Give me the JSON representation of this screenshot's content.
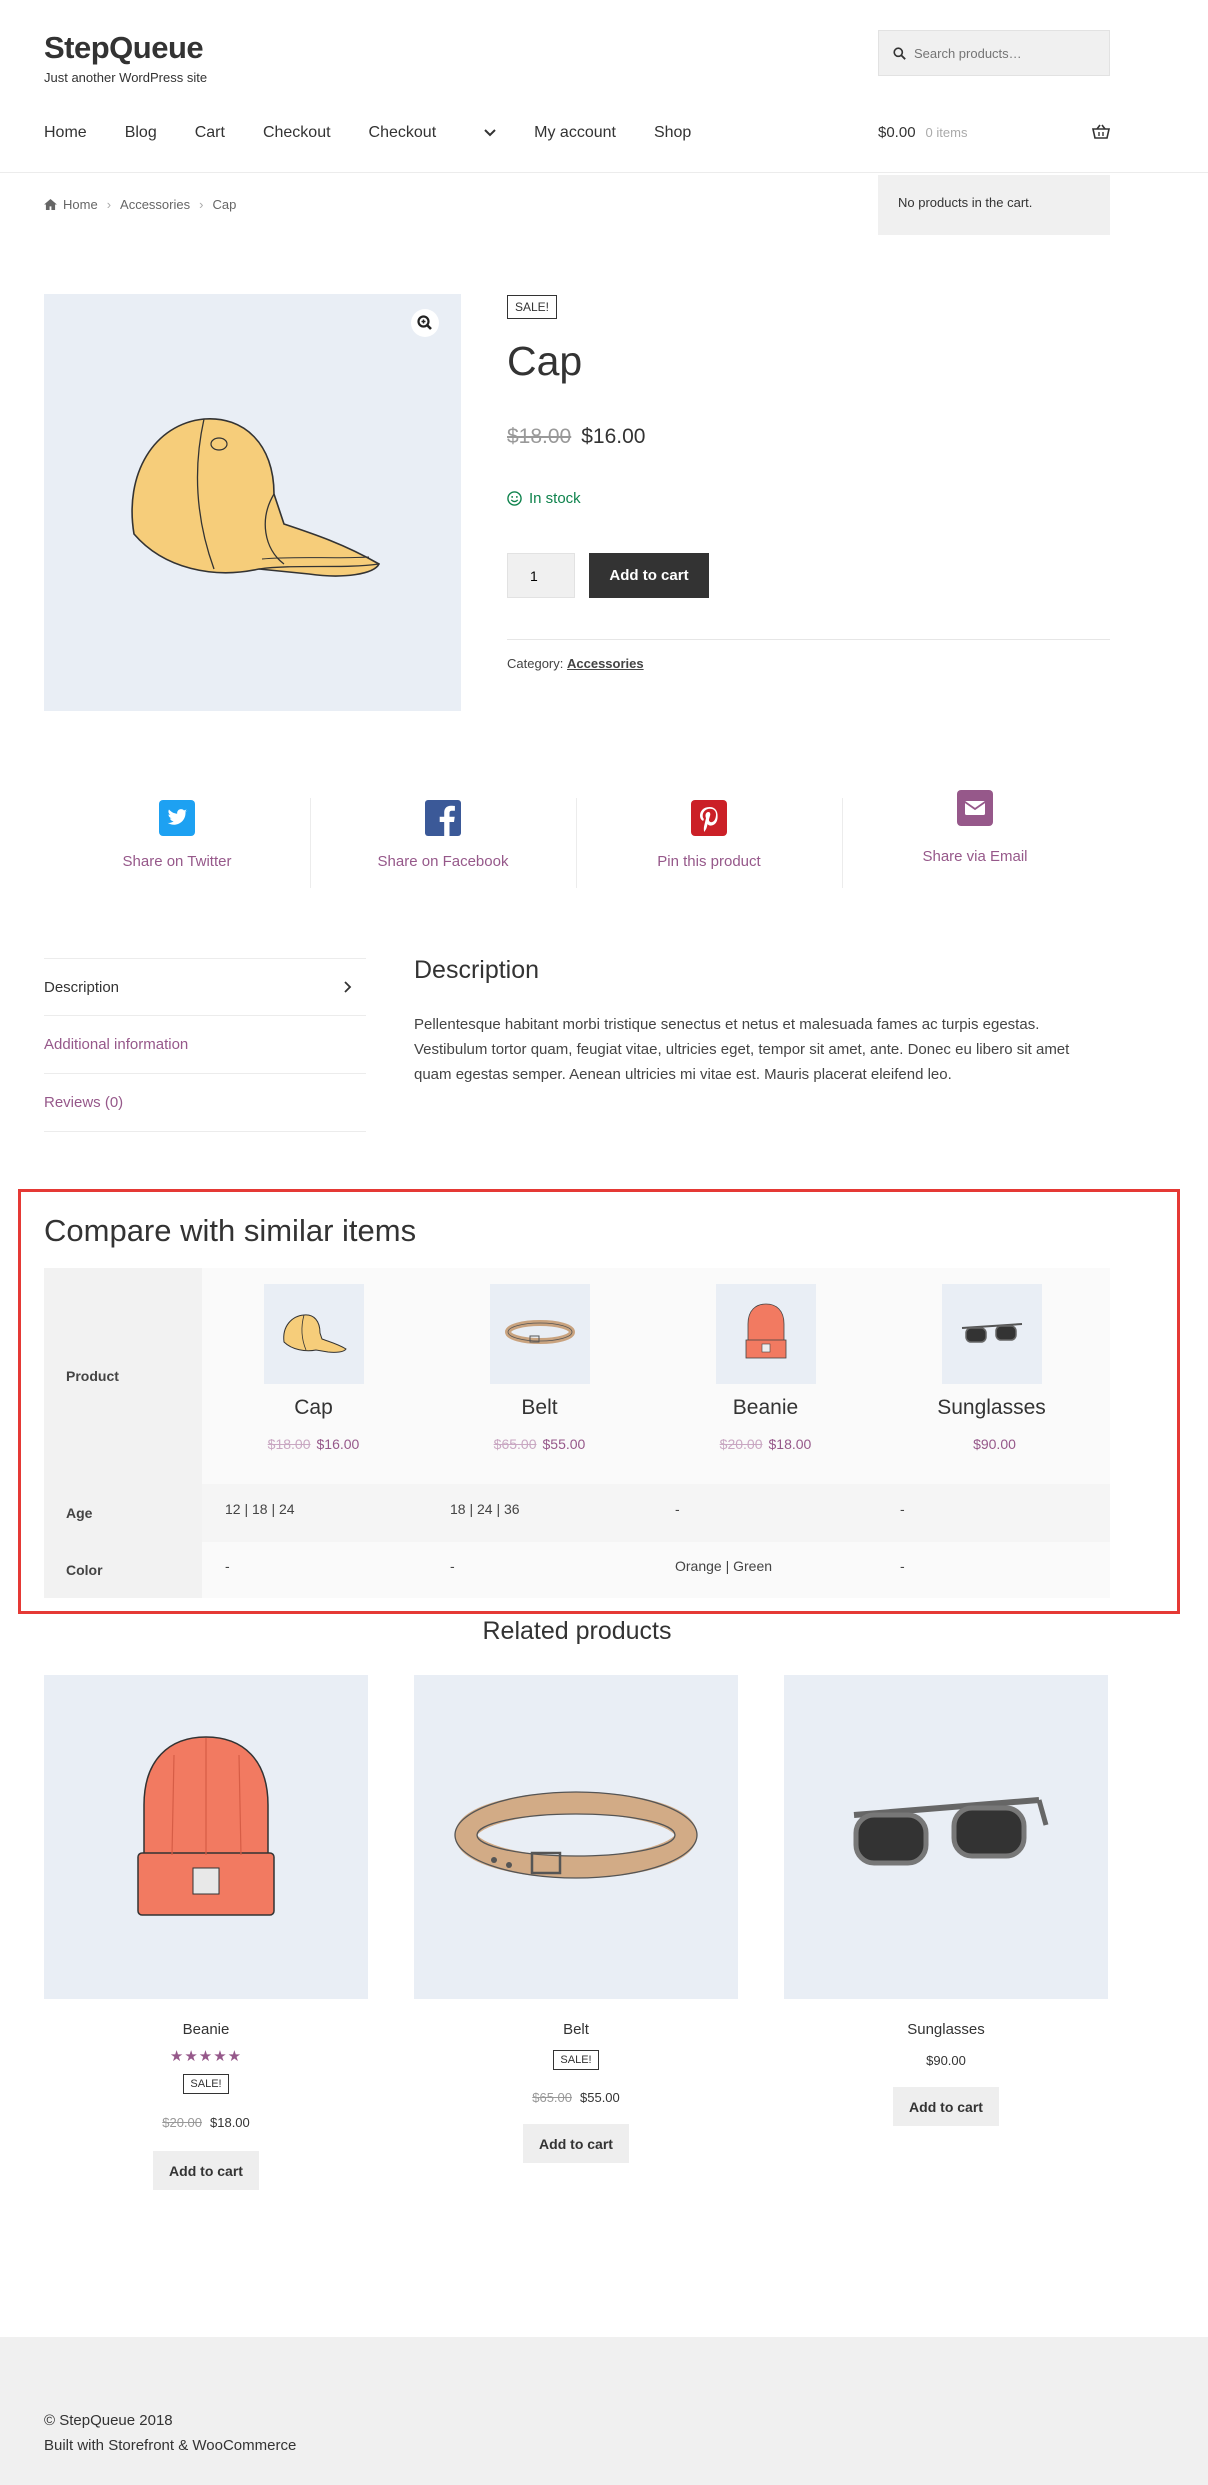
{
  "header": {
    "site_title": "StepQueue",
    "tagline": "Just another WordPress site",
    "search_placeholder": "Search products…"
  },
  "nav": {
    "items": [
      "Home",
      "Blog",
      "Cart",
      "Checkout",
      "Checkout",
      "My account",
      "Shop"
    ]
  },
  "cart": {
    "total": "$0.00",
    "count": "0 items",
    "dropdown_text": "No products in the cart."
  },
  "breadcrumb": [
    "Home",
    "Accessories",
    "Cap"
  ],
  "product": {
    "sale_badge": "SALE!",
    "title": "Cap",
    "old_price": "$18.00",
    "price": "$16.00",
    "stock": "In stock",
    "quantity": "1",
    "add_to_cart": "Add to cart",
    "category_label": "Category:",
    "category": "Accessories"
  },
  "share": [
    "Share on Twitter",
    "Share on Facebook",
    "Pin this product",
    "Share via Email"
  ],
  "tabs": [
    "Description",
    "Additional information",
    "Reviews (0)"
  ],
  "description": {
    "heading": "Description",
    "text": "Pellentesque habitant morbi tristique senectus et netus et malesuada fames ac turpis egestas. Vestibulum tortor quam, feugiat vitae, ultricies eget, tempor sit amet, ante. Donec eu libero sit amet quam egestas semper. Aenean ultricies mi vitae est. Mauris placerat eleifend leo."
  },
  "compare": {
    "heading": "Compare with similar items",
    "row_labels": [
      "Product",
      "Age",
      "Color"
    ],
    "items": [
      {
        "name": "Cap",
        "old_price": "$18.00",
        "price": "$16.00",
        "age": "12 | 18 | 24",
        "color": "-"
      },
      {
        "name": "Belt",
        "old_price": "$65.00",
        "price": "$55.00",
        "age": "18 | 24 | 36",
        "color": "-"
      },
      {
        "name": "Beanie",
        "old_price": "$20.00",
        "price": "$18.00",
        "age": "-",
        "color": "Orange | Green"
      },
      {
        "name": "Sunglasses",
        "old_price": "",
        "price": "$90.00",
        "age": "-",
        "color": "-"
      }
    ]
  },
  "related": {
    "heading": "Related products",
    "items": [
      {
        "name": "Beanie",
        "rating": "★★★★★",
        "sale": "SALE!",
        "old_price": "$20.00",
        "price": "$18.00",
        "button": "Add to cart"
      },
      {
        "name": "Belt",
        "sale": "SALE!",
        "old_price": "$65.00",
        "price": "$55.00",
        "button": "Add to cart"
      },
      {
        "name": "Sunglasses",
        "price": "$90.00",
        "button": "Add to cart"
      }
    ]
  },
  "footer": {
    "copyright": "© StepQueue 2018",
    "credit": "Built with Storefront & WooCommerce"
  },
  "colors": {
    "accent": "#96588a",
    "stock": "#0f834d",
    "highlight_border": "#e53935"
  }
}
